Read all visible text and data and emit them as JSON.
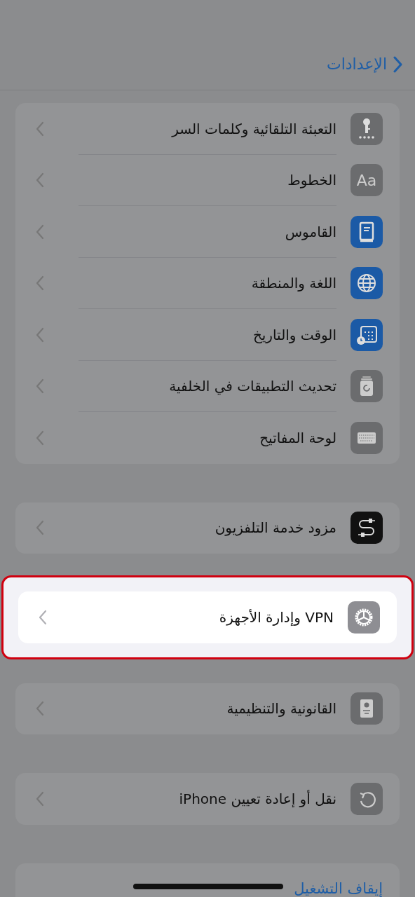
{
  "nav": {
    "back_label": "الإعدادات"
  },
  "groups": [
    {
      "highlighted": false,
      "items": [
        {
          "label": "التعبئة التلقائية وكلمات السر",
          "kind": "key"
        },
        {
          "label": "الخطوط",
          "kind": "fonts",
          "icon_text": "Aa"
        },
        {
          "label": "القاموس",
          "kind": "book"
        },
        {
          "label": "اللغة والمنطقة",
          "kind": "globe"
        },
        {
          "label": "الوقت والتاريخ",
          "kind": "calendar"
        },
        {
          "label": "تحديث التطبيقات في الخلفية",
          "kind": "refresh"
        },
        {
          "label": "لوحة المفاتيح",
          "kind": "keyboard"
        }
      ]
    },
    {
      "highlighted": false,
      "items": [
        {
          "label": "مزود خدمة التلفزيون",
          "kind": "cable"
        }
      ]
    },
    {
      "highlighted": true,
      "items": [
        {
          "label": "VPN وإدارة الأجهزة",
          "kind": "gear"
        }
      ]
    },
    {
      "highlighted": false,
      "items": [
        {
          "label": "القانونية والتنظيمية",
          "kind": "certificate"
        }
      ]
    },
    {
      "highlighted": false,
      "items": [
        {
          "label": "نقل أو إعادة تعيين iPhone",
          "kind": "reset"
        }
      ]
    },
    {
      "highlighted": false,
      "items": [
        {
          "label": "إيقاف التشغيل",
          "kind": "action"
        }
      ]
    }
  ]
}
